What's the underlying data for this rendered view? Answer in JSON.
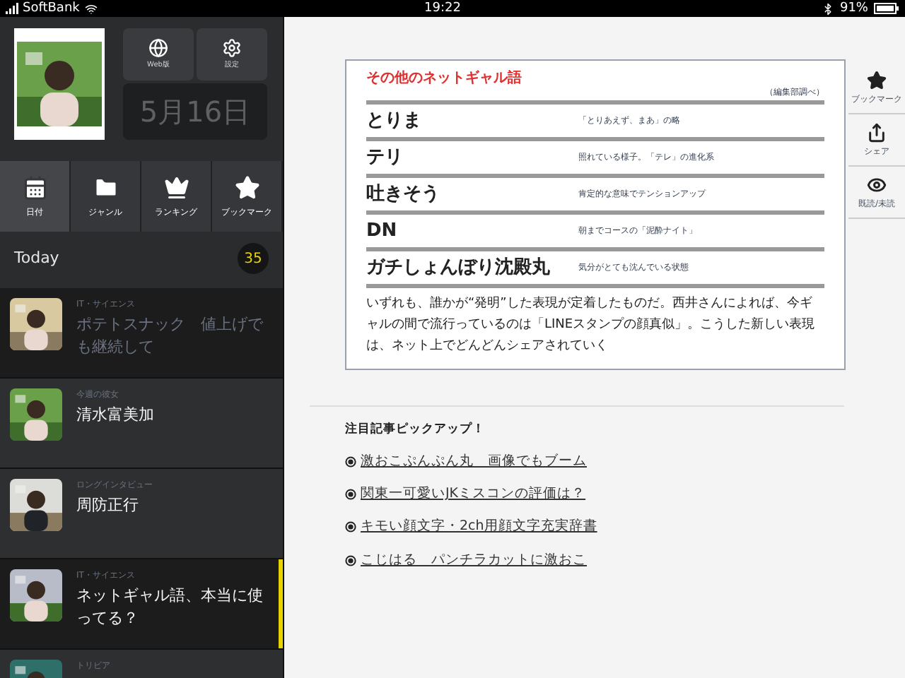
{
  "status_bar": {
    "carrier": "SoftBank",
    "time": "19:22",
    "battery": "91%"
  },
  "sidebar": {
    "top_buttons": [
      {
        "kind": "web",
        "label": "Web版"
      },
      {
        "kind": "settings",
        "label": "設定"
      }
    ],
    "date": "5月16日",
    "tabs": [
      {
        "kind": "calendar",
        "label": "日付",
        "selected": true
      },
      {
        "kind": "genre",
        "label": "ジャンル",
        "selected": false
      },
      {
        "kind": "ranking",
        "label": "ランキング",
        "selected": false
      },
      {
        "kind": "bookmark",
        "label": "ブックマーク",
        "selected": false
      }
    ],
    "section": {
      "title": "Today",
      "count": "35"
    },
    "articles": [
      {
        "category": "IT・サイエンス",
        "title": "ポテトスナック　値上げでも継続して",
        "read": true,
        "selected": false
      },
      {
        "category": "今週の彼女",
        "title": "清水富美加",
        "read": false,
        "selected": false
      },
      {
        "category": "ロングインタビュー",
        "title": "周防正行",
        "read": false,
        "selected": false
      },
      {
        "category": "IT・サイエンス",
        "title": "ネットギャル語、本当に使ってる？",
        "read": false,
        "selected": true
      },
      {
        "category": "トリビア",
        "read": false,
        "selected": false
      }
    ]
  },
  "article": {
    "table_title": "その他のネットギャル語",
    "table_note": "（編集部調べ）",
    "terms": [
      {
        "term": "とりま",
        "meaning": "「とりあえず、まあ」の略"
      },
      {
        "term": "テリ",
        "meaning": "照れている様子。「テレ」の進化系"
      },
      {
        "term": "吐きそう",
        "meaning": "肯定的な意味でテンションアップ"
      },
      {
        "term": "DN",
        "meaning": "朝までコースの「泥酔ナイト」"
      },
      {
        "term": "ガチしょんぼり沈殿丸",
        "meaning": "気分がとても沈んでいる状態"
      }
    ],
    "caption": "いずれも、誰かが“発明”した表現が定着したものだ。西井さんによれば、今ギャルの間で流行っているのは「LINEスタンプの顔真似」。こうした新しい表現は、ネット上でどんどんシェアされていく",
    "pickup_title": "注目記事ピックアップ！",
    "pickup_links": [
      "激おこぷんぷん丸　画像でもブーム",
      "関東一可愛いJKミスコンの評価は？",
      "キモい顔文字・2ch用顔文字充実辞書",
      "こじはる　パンチラカットに激おこ"
    ]
  },
  "toolbar": [
    {
      "kind": "bookmark",
      "label": "ブックマーク"
    },
    {
      "kind": "share",
      "label": "シェア"
    },
    {
      "kind": "read",
      "label": "既読/未読"
    }
  ]
}
